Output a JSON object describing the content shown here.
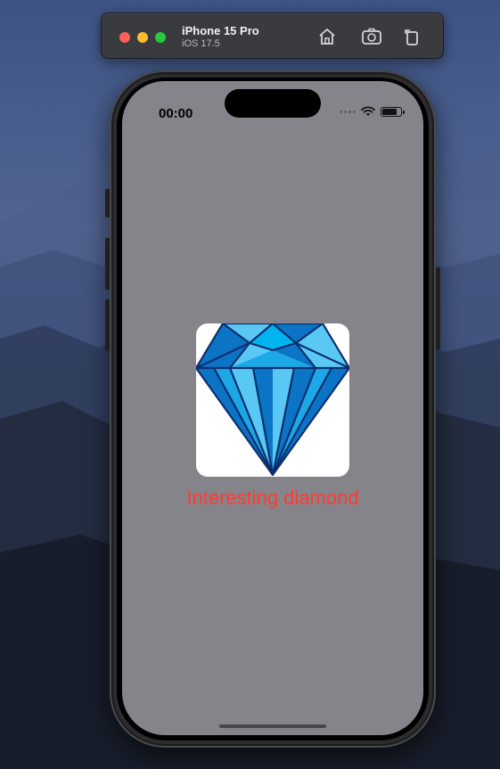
{
  "simulator": {
    "device_name": "iPhone 15 Pro",
    "os_version": "iOS 17.5",
    "toolbar_icons": [
      "home-icon",
      "screenshot-icon",
      "rotate-icon"
    ]
  },
  "status_bar": {
    "time": "00:00",
    "icons": [
      "signal-dots-icon",
      "wifi-icon",
      "battery-icon"
    ]
  },
  "content": {
    "image_icon": "diamond",
    "caption": "Interesting diamond",
    "caption_color": "#ff3b30"
  },
  "colors": {
    "screen_background": "#85848a",
    "diamond_light": "#5ac8f5",
    "diamond_mid": "#1ca7e6",
    "diamond_dark": "#0b74c5",
    "diamond_outline": "#0d2f6e"
  }
}
